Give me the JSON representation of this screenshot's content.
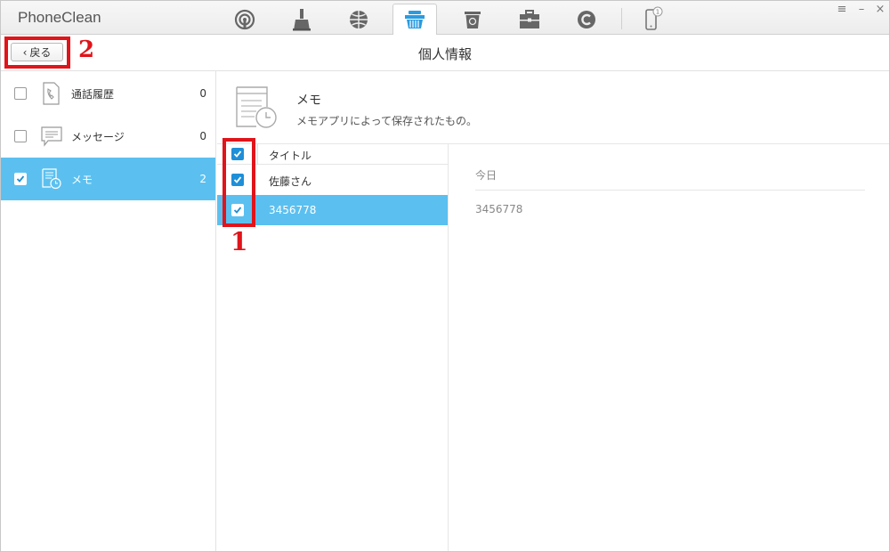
{
  "app": {
    "title": "PhoneClean"
  },
  "toolbar": {
    "tools": [
      {
        "icon": "signal-icon"
      },
      {
        "icon": "broom-icon"
      },
      {
        "icon": "globe-icon"
      },
      {
        "icon": "basket-icon",
        "active": true
      },
      {
        "icon": "recycle-bin-icon"
      },
      {
        "icon": "toolbox-icon"
      },
      {
        "icon": "refresh-c-icon"
      },
      {
        "icon": "phone-icon",
        "badge": "1"
      }
    ]
  },
  "header": {
    "back_label": "戻る",
    "title": "個人情報"
  },
  "sidebar": {
    "items": [
      {
        "label": "通話履歴",
        "count": "0",
        "icon": "phone-log-icon",
        "checked": false,
        "selected": false
      },
      {
        "label": "メッセージ",
        "count": "0",
        "icon": "message-icon",
        "checked": false,
        "selected": false
      },
      {
        "label": "メモ",
        "count": "2",
        "icon": "memo-icon",
        "checked": true,
        "selected": true
      }
    ]
  },
  "info": {
    "title": "メモ",
    "description": "メモアプリによって保存されたもの。"
  },
  "list": {
    "header_label": "タイトル",
    "rows": [
      {
        "title": "佐藤さん",
        "checked": true,
        "selected": false
      },
      {
        "title": "3456778",
        "checked": true,
        "selected": true
      }
    ]
  },
  "detail": {
    "date": "今日",
    "body": "3456778"
  },
  "annotations": {
    "label_1": "1",
    "label_2": "2"
  },
  "colors": {
    "accent": "#5bc0f0",
    "checkbox": "#1e8fd8",
    "annotation": "#e0141a"
  }
}
